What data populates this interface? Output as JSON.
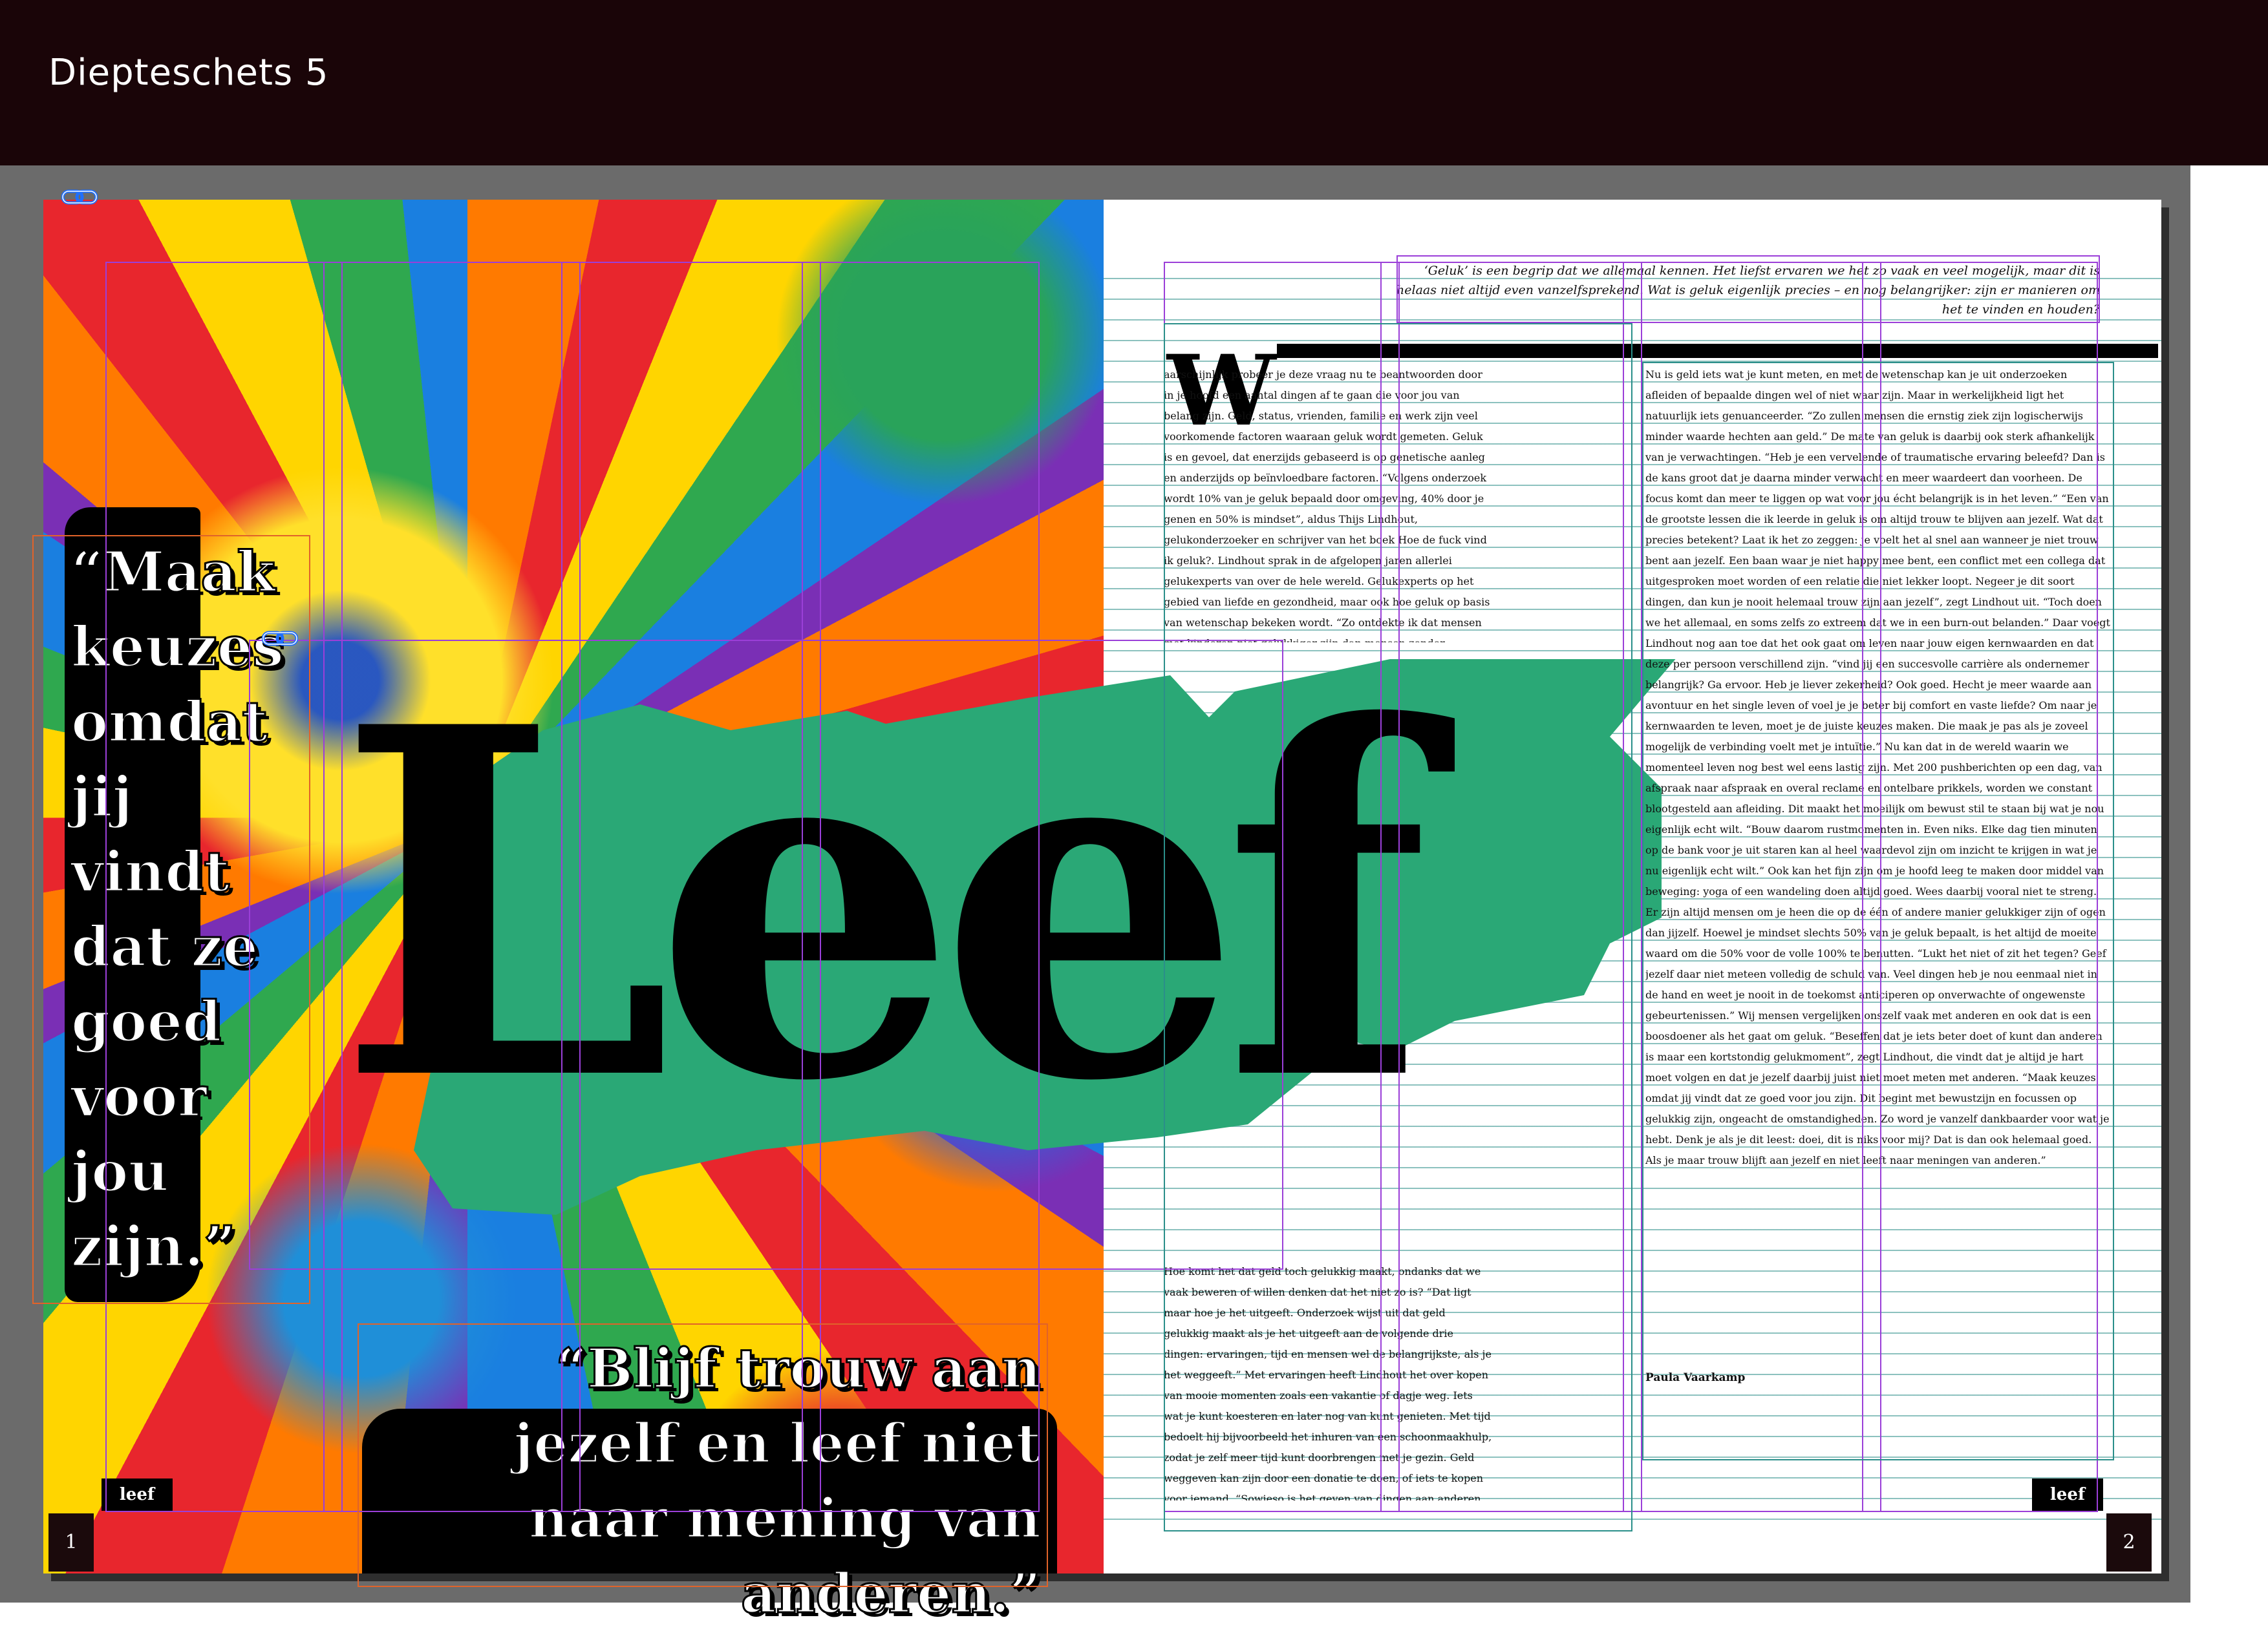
{
  "window": {
    "title": "Diepteschets 5"
  },
  "left_page": {
    "quote_left": "“Maak keuzes omdat jij vindt dat ze goed voor jou zijn.”",
    "quote_bottom": "“Blijf trouw aan jezelf en leef niet naar mening van anderen.”",
    "folio_label": "leef",
    "page_number": "1"
  },
  "headline": {
    "text": "Leef"
  },
  "right_page": {
    "intro": "‘Geluk’ is een begrip dat we allemaal kennen. Het liefst ervaren we het zo vaak en veel mogelijk, maar dit is helaas niet altijd even vanzelfsprekend. Wat is geluk eigenlijk precies – en nog belangrijker: zijn er manieren om het te vinden en houden?",
    "drop_cap": "W",
    "col1_top": "aarschijnlijk probeer je deze vraag nu te beantwoorden door in je hoofd een aantal dingen af te gaan die voor jou van belang zijn. Geld, status, vrienden, familie en werk zijn veel voorkomende factoren waaraan geluk wordt gemeten. Geluk is en gevoel, dat enerzijds gebaseerd is op genetische aanleg en anderzijds op beïnvloedbare factoren. “Volgens onderzoek wordt 10% van je geluk bepaald door omgeving, 40% door je genen en 50% is mindset”, aldus Thijs Lindhout, gelukonderzoeker en schrijver van het boek Hoe de fuck vind ik geluk?. Lindhout sprak in de afgelopen jaren allerlei gelukexperts van over de hele wereld. Gelukexperts op het gebied van liefde en gezondheid, maar ook hoe geluk op basis van wetenschap bekeken wordt. “Zo ontdekte ik dat mensen met kinderen niet gelukkiger zijn dan mensen zonder kinderen – en dat geld gelukkiger maakt dan wij denken.”",
    "col1_bottom": "Hoe komt het dat geld toch gelukkig maakt, ondanks dat we vaak beweren of willen denken dat het niet zo is? “Dat ligt maar hoe je het uitgeeft. Onderzoek wijst uit dat geld gelukkig maakt als je het uitgeeft aan de volgende drie dingen: ervaringen, tijd en mensen wel de belangrijkste, als je het weggeeft.” Met ervaringen heeft Lindhout het over kopen van mooie momenten zoals een vakantie of dagje weg. Iets wat je kunt koesteren en later nog van kunt genieten. Met tijd bedoelt hij bijvoorbeeld het inhuren van een schoonmaakhulp, zodat je zelf meer tijd kunt doorbrengen met je gezin. Geld weggeven kan zijn door een donatie te doen, of iets te kopen voor iemand. “Sowieso is het geven van dingen aan anderen belangrijk voor je eigen geluk. Zeker als je daarmee de ander kunt helpen in zijn of haar groei. Zingeving is het hoogste niveau van geluk.”",
    "col2": "Nu is geld iets wat je kunt meten, en met de wetenschap kan je uit onderzoeken afleiden of bepaalde dingen wel of niet waar zijn. Maar in werkelijkheid ligt het natuurlijk iets genuanceerder. “Zo zullen mensen die ernstig ziek zijn logischerwijs minder waarde hechten aan geld.” De mate van geluk is daarbij ook sterk afhankelijk van je verwachtingen. “Heb je een vervelende of traumatische ervaring beleefd? Dan is de kans groot dat je daarna minder verwacht en meer waardeert dan voorheen. De focus komt dan meer te liggen op wat voor jou écht belangrijk is in het leven.” “Een van de grootste lessen die ik leerde in geluk is om altijd trouw te blijven aan jezelf. Wat dat precies betekent? Laat ik het zo zeggen: je voelt het al snel aan wanneer je niet trouw bent aan jezelf. Een baan waar je niet happy mee bent, een conflict met een collega dat uitgesproken moet worden of een relatie die niet lekker loopt. Negeer je dit soort dingen, dan kun je nooit helemaal trouw zijn aan jezelf”, zegt Lindhout uit. “Toch doen we het allemaal, en soms zelfs zo extreem dat we in een burn-out belanden.” Daar voegt Lindhout nog aan toe dat het ook gaat om leven naar jouw eigen kernwaarden en dat deze per persoon verschillend zijn. “vind jij een succesvolle carrière als ondernemer belangrijk? Ga ervoor. Heb je liever zekerheid? Ook goed. Hecht je meer waarde aan avontuur en het single leven of voel je je beter bij comfort en vaste liefde? Om naar je kernwaarden te leven, moet je de juiste keuzes maken. Die maak je pas als je zoveel mogelijk de verbinding voelt met je intuïtie.” Nu kan dat in de wereld waarin we momenteel leven nog best wel eens lastig zijn. Met 200 pushberichten op een dag, van afspraak naar afspraak en overal reclame en ontelbare prikkels, worden we constant blootgesteld aan afleiding. Dit maakt het moeilijk om bewust stil te staan bij wat je nou eigenlijk echt wilt. “Bouw daarom rustmomenten in. Even niks. Elke dag tien minuten op de bank voor je uit staren kan al heel waardevol zijn om inzicht te krijgen in wat je nu eigenlijk echt wilt.” Ook kan het fijn zijn om je hoofd leeg te maken door middel van beweging: yoga of een wandeling doen altijd goed. Wees daarbij vooral niet te streng. Er zijn altijd mensen om je heen die op de één of andere manier gelukkiger zijn of ogen dan jijzelf. Hoewel je mindset slechts 50% van je geluk bepaalt, is het altijd de moeite waard om die 50% voor de volle 100% te benutten. “Lukt het niet of zit het tegen? Geef jezelf daar niet meteen volledig de schuld van. Veel dingen heb je nou eenmaal niet in de hand en weet je nooit in de toekomst anticiperen op onverwachte of ongewenste gebeurtenissen.” Wij mensen vergelijken onszelf vaak met anderen en ook dat is een boosdoener als het gaat om geluk. “Beseffen dat je iets beter doet of kunt dan anderen is maar een kortstondig gelukmoment”, zegt Lindhout, die vindt dat je altijd je hart moet volgen en dat je jezelf daarbij juist niet moet meten met anderen. “Maak keuzes omdat jij vindt dat ze goed voor jou zijn. Dit begint met bewustzijn en focussen op gelukkig zijn, ongeacht de omstandigheden. Zo word je vanzelf dankbaarder voor wat je hebt. Denk je als je dit leest: doei, dit is niks voor mij? Dat is dan ook helemaal goed. Als je maar trouw blijft aan jezelf en niet leeft naar meningen van anderen.”",
    "signature": "Paula Vaarkamp",
    "folio_label": "leef",
    "page_number": "2"
  },
  "colors": {
    "top_bar": "#1a0508",
    "workspace": "#6b6b6b",
    "green_accent": "#2aa876",
    "frame_guide": "#9b3fd8",
    "margin_guide": "#e0632a",
    "baseline_grid": "#2f8f8a"
  },
  "icons": [
    "link-icon"
  ]
}
